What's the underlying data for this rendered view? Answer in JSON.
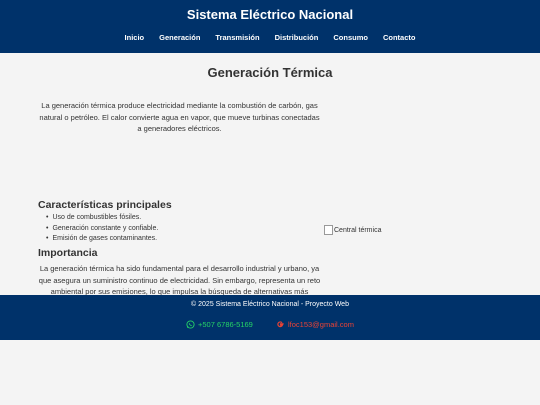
{
  "header": {
    "title": "Sistema Eléctrico Nacional",
    "nav": [
      "Inicio",
      "Generación",
      "Transmisión",
      "Distribución",
      "Consumo",
      "Contacto"
    ]
  },
  "main": {
    "title": "Generación Térmica",
    "intro": "La generación térmica produce electricidad mediante la combustión de carbón, gas natural o petróleo. El calor convierte agua en vapor, que mueve turbinas conectadas a generadores eléctricos.",
    "features_heading": "Características principales",
    "features": [
      "Uso de combustibles fósiles.",
      "Generación constante y confiable.",
      "Emisión de gases contaminantes."
    ],
    "importance_heading": "Importancia",
    "importance_text": "La generación térmica ha sido fundamental para el desarrollo industrial y urbano, ya que asegura un suministro continuo de electricidad. Sin embargo, representa un reto ambiental por sus emisiones, lo que impulsa la búsqueda de alternativas más limpias.",
    "image_alt": "Central térmica"
  },
  "footer": {
    "copyright": "© 2025 Sistema Eléctrico Nacional - Proyecto Web",
    "phone": "+507 6786-5169",
    "email": "lfoc153@gmail.com",
    "phone_icon": "whatsapp-icon",
    "email_icon": "google-icon"
  },
  "colors": {
    "header_bg": "#00326a",
    "page_bg": "#f4f4f4",
    "phone": "#25d366",
    "email": "#ea4335"
  }
}
